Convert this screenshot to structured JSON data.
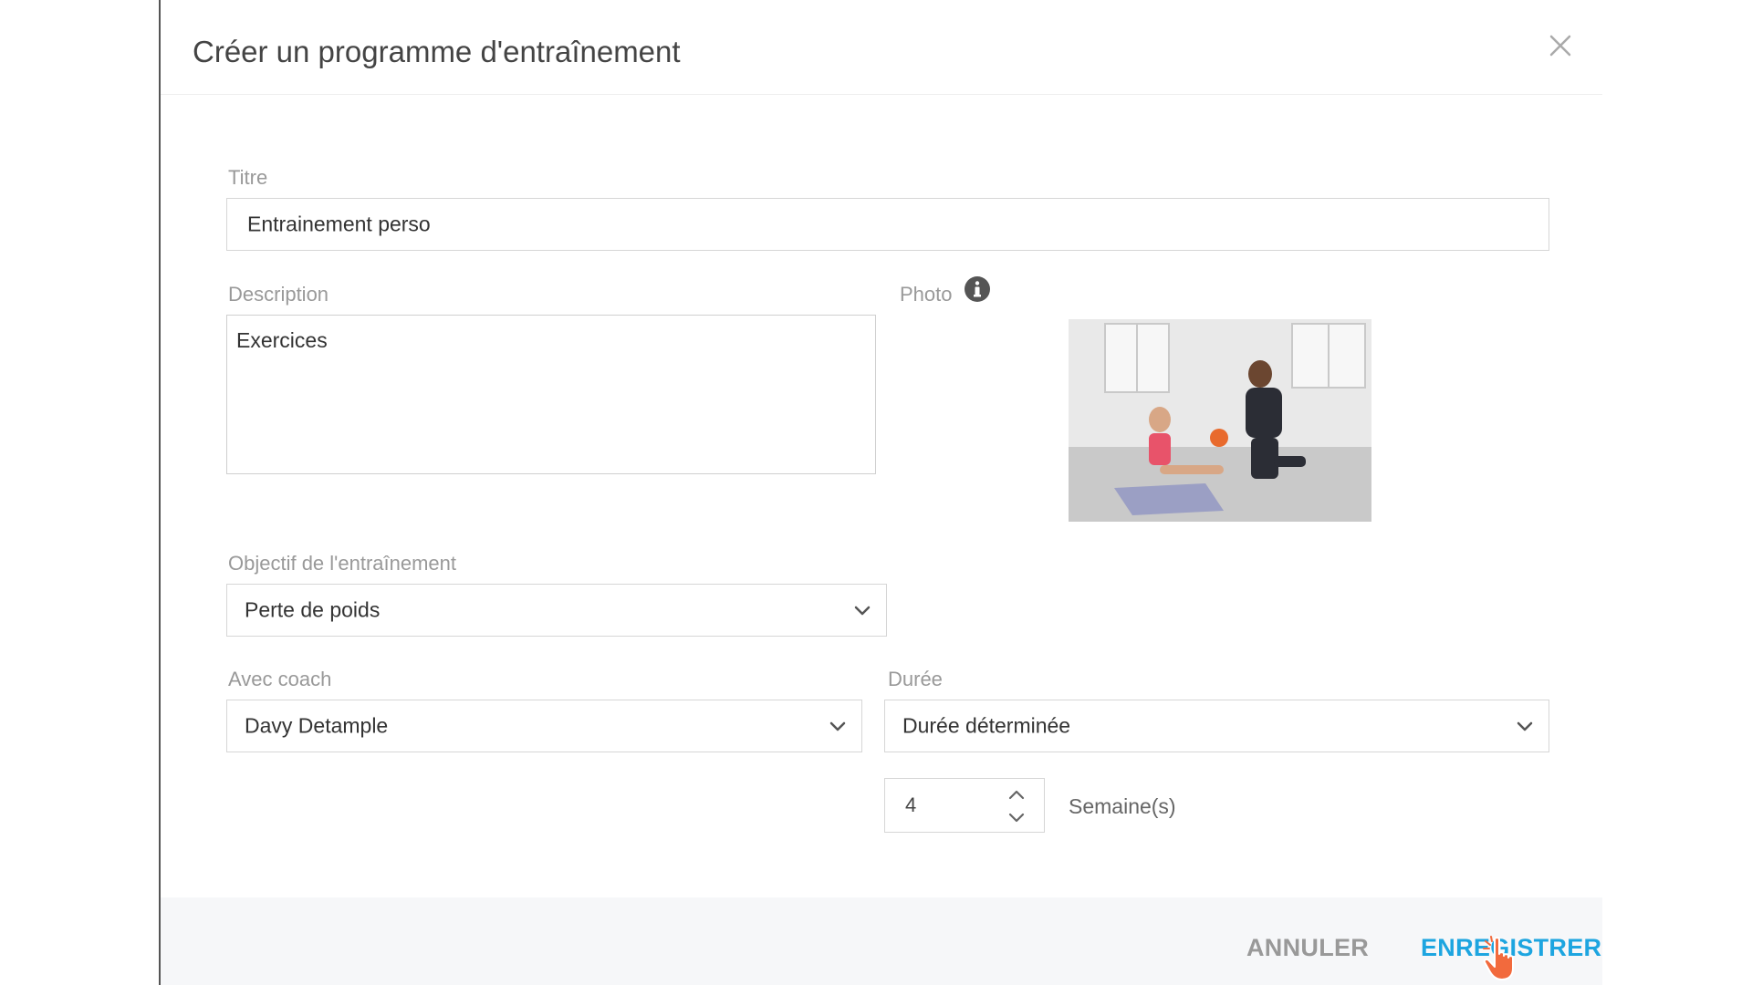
{
  "modal": {
    "title": "Créer un programme d'entraînement",
    "close_icon": "close-icon"
  },
  "form": {
    "title_label": "Titre",
    "title_value": "Entrainement perso",
    "description_label": "Description",
    "description_value": "Exercices",
    "photo_label": "Photo",
    "photo_info_icon": "info-circle-icon",
    "objective_label": "Objectif de l'entraînement",
    "objective_value": "Perte de poids",
    "coach_label": "Avec coach",
    "coach_value": "Davy Detample",
    "duration_label": "Durée",
    "duration_value": "Durée déterminée",
    "duration_amount": "4",
    "duration_unit": "Semaine(s)"
  },
  "footer": {
    "cancel_label": "ANNULER",
    "save_label": "ENREGISTRER"
  },
  "colors": {
    "accent": "#1da5e0",
    "muted": "#999999",
    "footer_bg": "#f6f7f9",
    "cursor": "#f26a3d"
  }
}
